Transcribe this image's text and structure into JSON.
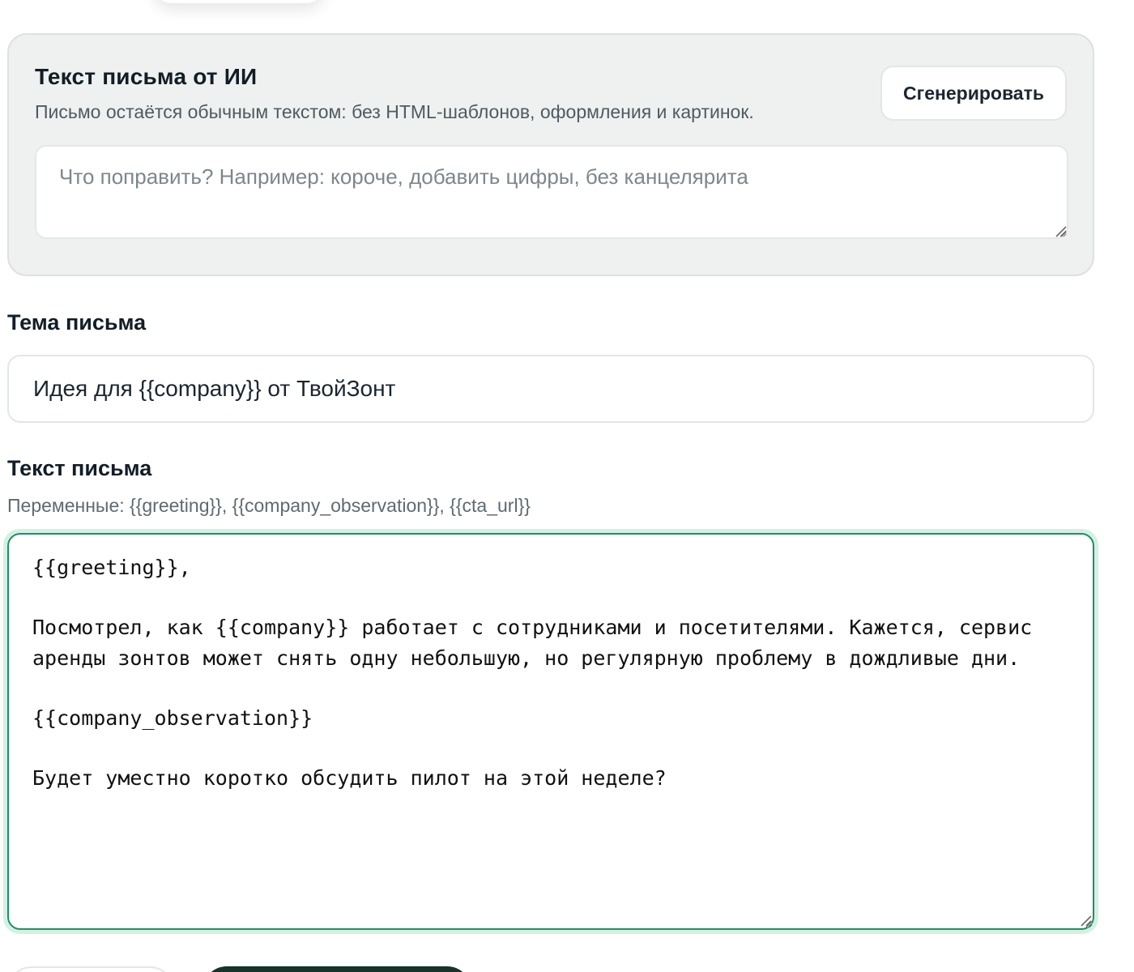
{
  "ai_card": {
    "title": "Текст письма от ИИ",
    "subtitle": "Письмо остаётся обычным текстом: без HTML-шаблонов, оформления и картинок.",
    "generate_label": "Сгенерировать",
    "prompt_value": "",
    "prompt_placeholder": "Что поправить? Например: короче, добавить цифры, без канцелярита"
  },
  "subject": {
    "label": "Тема письма",
    "value": "Идея для {{company}} от ТвойЗонт"
  },
  "body": {
    "label": "Текст письма",
    "variables_hint": "Переменные: {{greeting}}, {{company_observation}}, {{cta_url}}",
    "value": "{{greeting}},\n\nПосмотрел, как {{company}} работает с сотрудниками и посетителями. Кажется, сервис аренды зонтов может снять одну небольшую, но регулярную проблему в дождливые дни.\n\n{{company_observation}}\n\nБудет уместно коротко обсудить пилот на этой неделе?"
  },
  "icons": {
    "resize": "resize-grip-icon"
  },
  "colors": {
    "card_background": "#eef1ef",
    "focus_border": "#1f8f66",
    "focus_ring": "#d3f1e3",
    "primary_button": "#17332b"
  }
}
